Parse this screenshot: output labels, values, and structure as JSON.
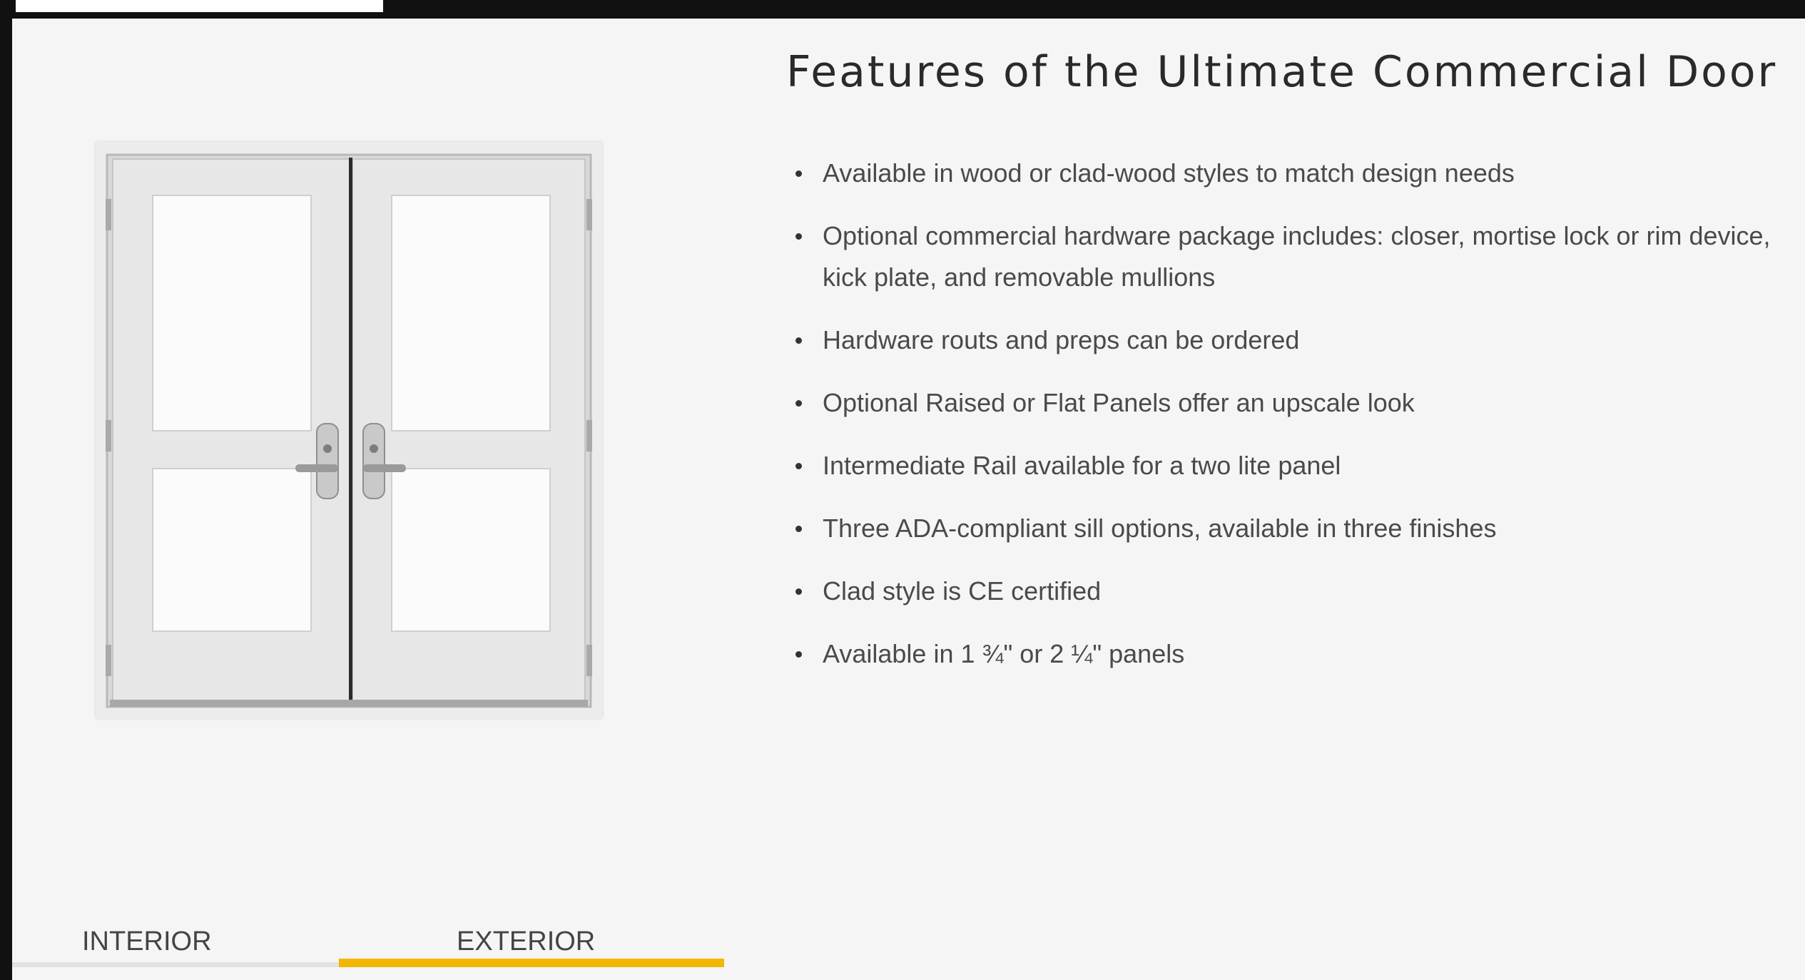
{
  "section": {
    "title": "Features of the Ultimate Commercial Door"
  },
  "features": [
    "Available in wood or clad-wood styles to match design needs",
    "Optional commercial hardware package includes: closer, mortise lock or rim device, kick plate, and removable mullions",
    "Hardware routs and preps can be ordered",
    "Optional Raised or Flat Panels offer an upscale look",
    "Intermediate Rail available for a two lite panel",
    "Three ADA-compliant sill options, available in three finishes",
    "Clad style is CE certified",
    "Available in 1 ¾\" or 2 ¼\" panels"
  ],
  "tabs": [
    {
      "label": "INTERIOR",
      "active": false
    },
    {
      "label": "EXTERIOR",
      "active": true
    }
  ],
  "colors": {
    "active_tab_underline": "#f2b705",
    "inactive_tab_underline": "#e2e2e2",
    "background": "#f5f5f5"
  },
  "image": {
    "subject": "double-door-exterior-icon"
  }
}
